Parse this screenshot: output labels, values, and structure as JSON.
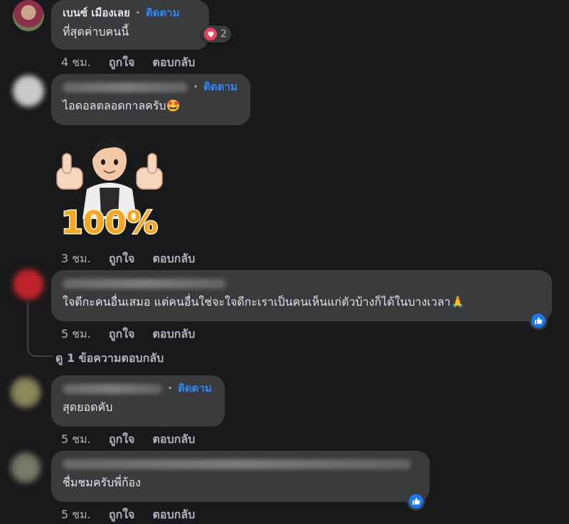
{
  "comments": [
    {
      "author": "เบนซ์ เมืองเลย",
      "follow_label": "ติดตาม",
      "separator": "·",
      "text": "ที่สุดค่าบคนนี้",
      "reaction_count": "2",
      "time": "4 ชม.",
      "like_label": "ถูกใจ",
      "reply_label": "ตอบกลับ"
    },
    {
      "author": "",
      "follow_label": "ติดตาม",
      "separator": "·",
      "text": "ไอดอลตลอดกาลครับ🤩",
      "sticker_text": "100%",
      "time": "3 ชม.",
      "like_label": "ถูกใจ",
      "reply_label": "ตอบกลับ"
    },
    {
      "author": "",
      "text": "ใจดีกะคนอื่นเสมอ แต่คนอื่นใช่จะใจดีกะเราเป็นคนเห็นแก่ตัวบ้างก็ได้ในบางเวลา🙏",
      "time": "5 ชม.",
      "like_label": "ถูกใจ",
      "reply_label": "ตอบกลับ",
      "view_replies": "ดู 1 ข้อความตอบกลับ"
    },
    {
      "author": "",
      "follow_label": "ติดตาม",
      "separator": "·",
      "text": "สุดยอดคับ",
      "time": "5 ชม.",
      "like_label": "ถูกใจ",
      "reply_label": "ตอบกลับ"
    },
    {
      "author": "",
      "text": "ชื่มชมครับพี่ก้อง",
      "time": "5 ชม.",
      "like_label": "ถูกใจ",
      "reply_label": "ตอบกลับ"
    }
  ],
  "colors": {
    "background": "#18191a",
    "bubble": "#3a3b3c",
    "follow": "#2d88ff",
    "like": "#1877f2",
    "love": "#f33e58"
  }
}
